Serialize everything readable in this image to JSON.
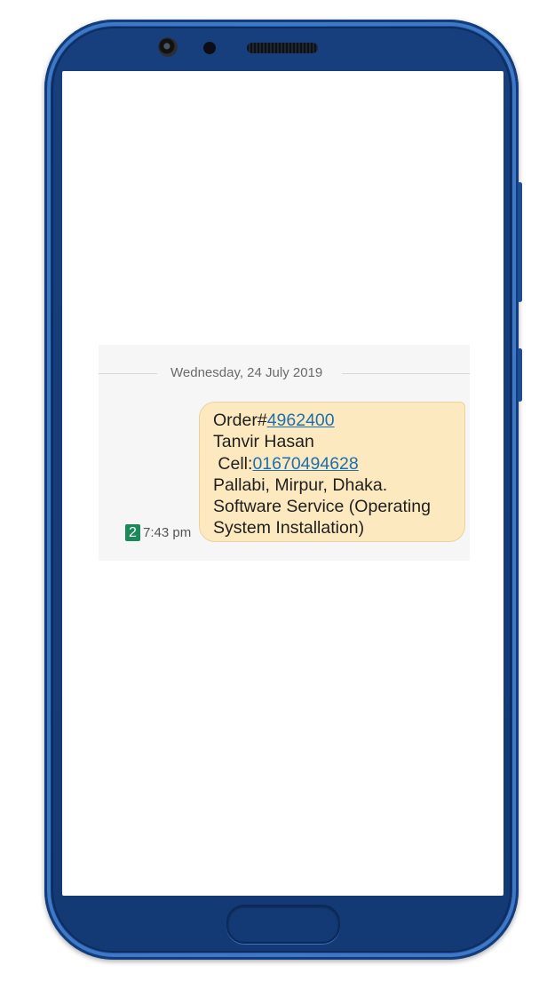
{
  "conversation": {
    "date_separator": "Wednesday, 24 July 2019",
    "message": {
      "order_prefix": "Order#",
      "order_number": "4962400",
      "name": "Tanvir Hasan",
      "cell_prefix": " Cell:",
      "cell_number": "01670494628",
      "address": "Pallabi, Mirpur, Dhaka.",
      "service_line1": "Software Service (Operating",
      "service_line2": "System Installation)"
    },
    "sim_slot": "2",
    "time": "7:43 pm"
  },
  "colors": {
    "bubble_background": "#fde9bf",
    "link": "#1d6fb0",
    "sim_badge": "#1b8a5a",
    "phone_frame": "#2a63b5"
  },
  "icons": {
    "sim": "sim-2-badge-icon"
  }
}
